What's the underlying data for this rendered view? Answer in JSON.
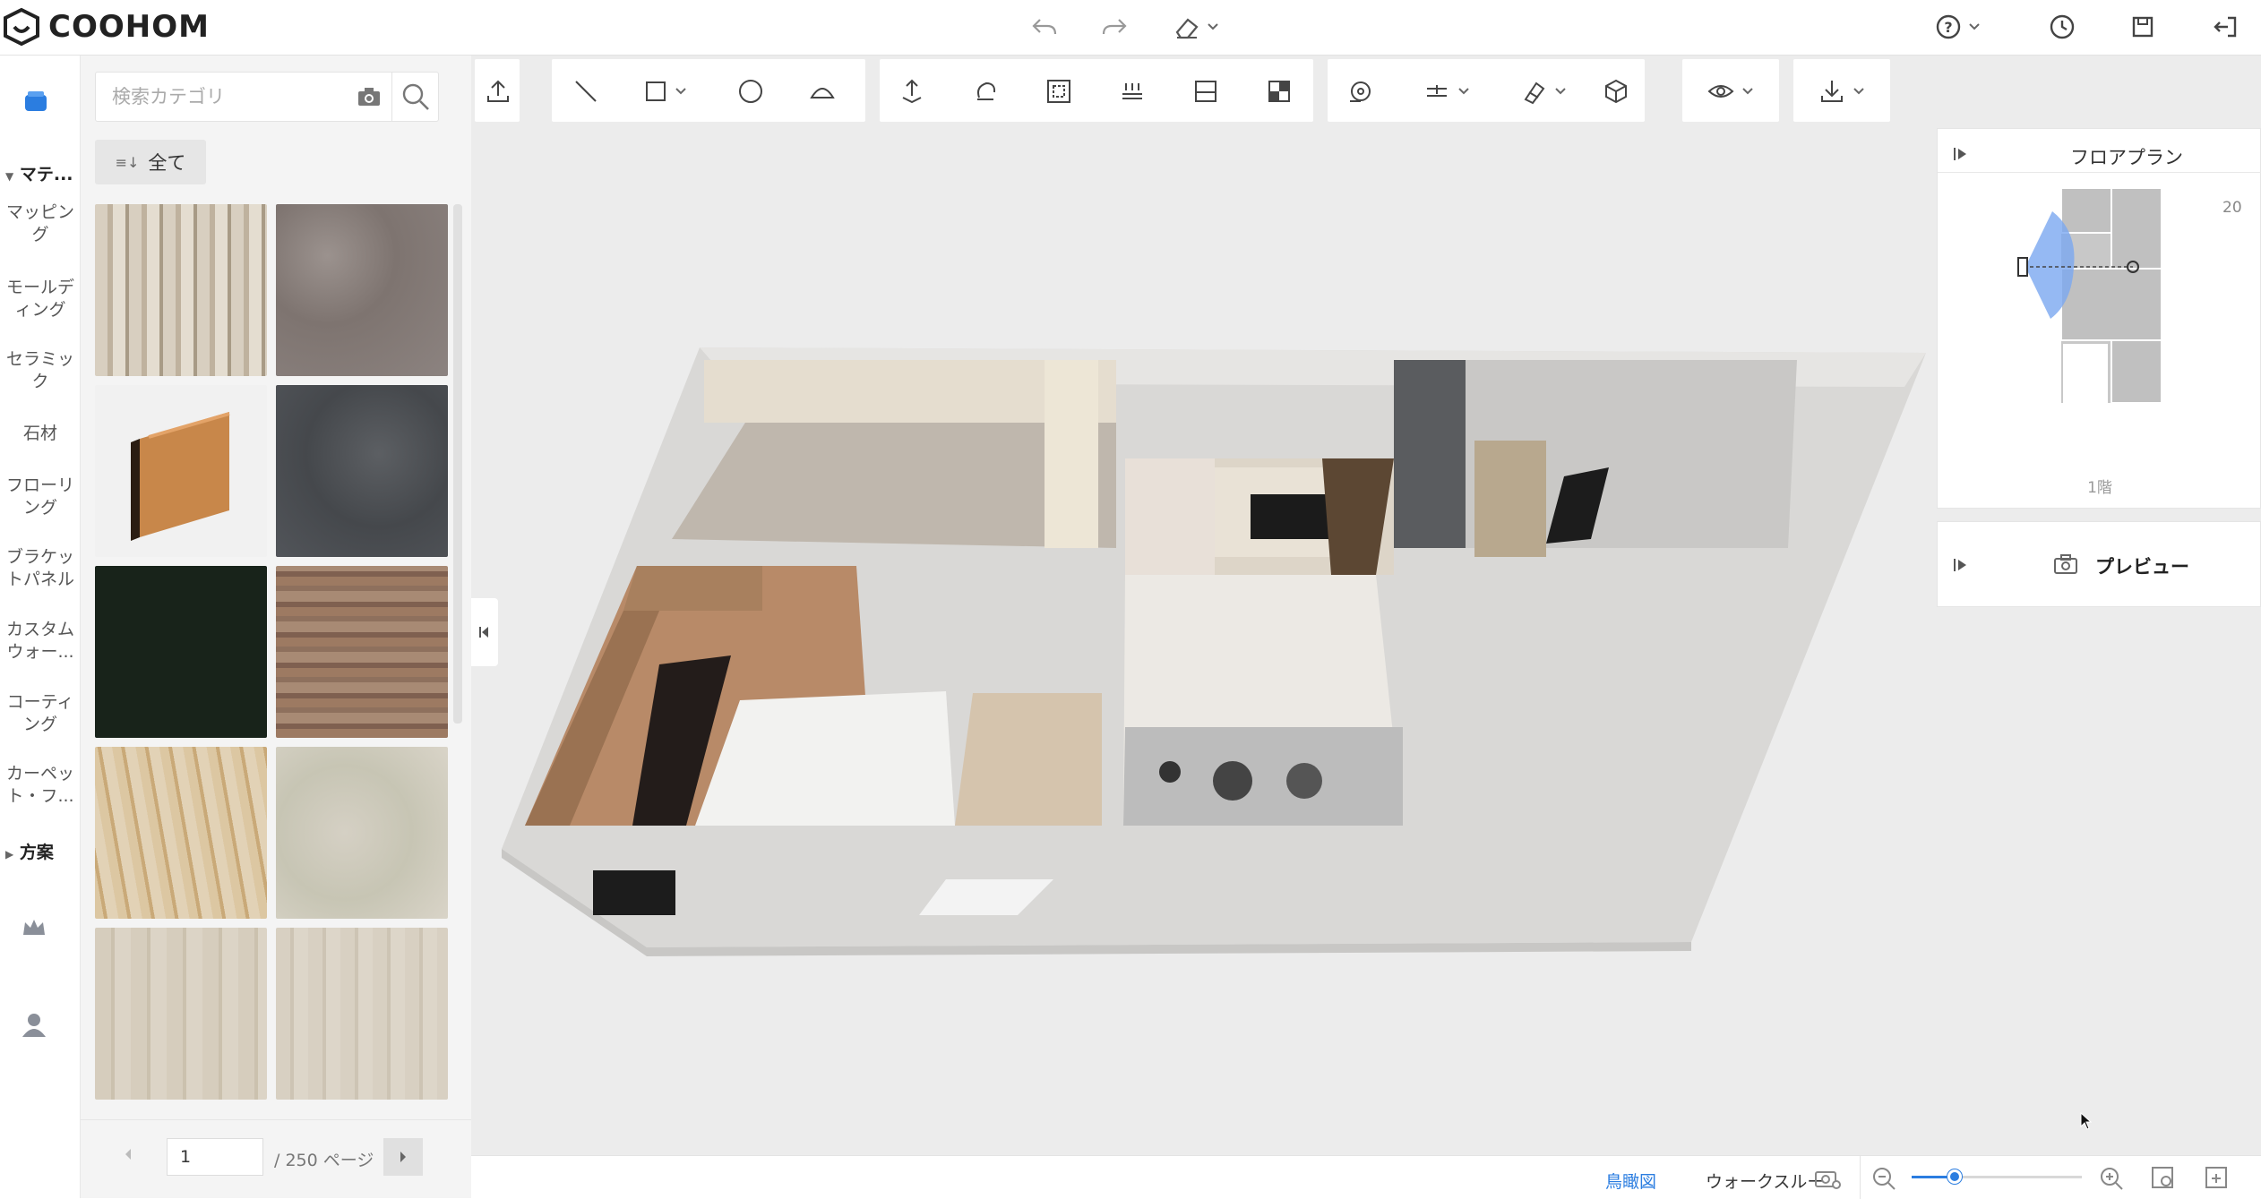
{
  "app": {
    "logo_text": "COOHOM"
  },
  "sidebar": {
    "section_materials": "マテ...",
    "items": [
      {
        "label": "マッピング"
      },
      {
        "label": "モールディング"
      },
      {
        "label": "セラミック"
      },
      {
        "label": "石材"
      },
      {
        "label": "フローリング"
      },
      {
        "label": "ブラケットパネル"
      },
      {
        "label": "カスタムウォー..."
      },
      {
        "label": "コーティング"
      },
      {
        "label": "カーペット・フ..."
      }
    ],
    "section_plans": "方案"
  },
  "panel": {
    "search_placeholder": "検索カテゴリ",
    "filter_label": "全て",
    "pager": {
      "current": "1",
      "total": "/ 250 ページ"
    }
  },
  "floorplan": {
    "title": "フロアプラン",
    "scale": "20",
    "floor_label": "1階"
  },
  "preview": {
    "title": "プレビュー"
  },
  "bottom": {
    "view_birdseye": "鳥瞰図",
    "view_walkthrough": "ウォークスルー"
  },
  "zoom": {
    "level": 0.25
  },
  "colors": {
    "accent": "#2b7de0",
    "sidebar_icon": "#2b7de0"
  }
}
